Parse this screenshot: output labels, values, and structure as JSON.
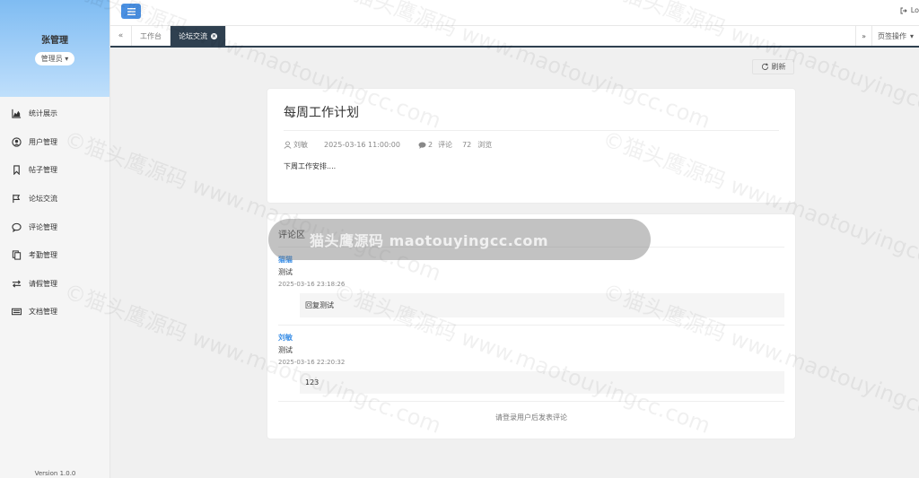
{
  "sidebar": {
    "user_name": "张管理",
    "role": "管理员",
    "items": [
      {
        "label": "统计展示",
        "icon": "area-chart-icon"
      },
      {
        "label": "用户管理",
        "icon": "user-circle-icon"
      },
      {
        "label": "帖子管理",
        "icon": "bookmark-icon"
      },
      {
        "label": "论坛交流",
        "icon": "flag-icon"
      },
      {
        "label": "评论管理",
        "icon": "comment-icon"
      },
      {
        "label": "考勤管理",
        "icon": "copy-icon"
      },
      {
        "label": "请假管理",
        "icon": "exchange-icon"
      },
      {
        "label": "文档管理",
        "icon": "keyboard-icon"
      }
    ],
    "version": "Version 1.0.0"
  },
  "topbar": {
    "logout_label": "Lo"
  },
  "tabs": {
    "items": [
      {
        "label": "工作台",
        "active": false
      },
      {
        "label": "论坛交流",
        "active": true
      }
    ],
    "page_ops_label": "页签操作"
  },
  "main": {
    "refresh_label": "刷新",
    "post": {
      "title": "每周工作计划",
      "author": "刘敏",
      "datetime": "2025-03-16 11:00:00",
      "comment_count": "2",
      "comment_label": "评论",
      "view_count": "72",
      "view_label": "浏览",
      "content": "下周工作安排...."
    },
    "comments": {
      "heading": "评论区",
      "items": [
        {
          "author": "猫猫",
          "text": "测试",
          "time": "2025-03-16 23:18:26",
          "reply": "回复测试"
        },
        {
          "author": "刘敏",
          "text": "测试",
          "time": "2025-03-16 22:20:32",
          "reply": "123"
        }
      ],
      "login_hint": "请登录用户后发表评论"
    }
  },
  "watermark": {
    "pill_text": "猫头鹰源码 maotouyingcc.com",
    "text": "©猫头鹰源码 www.maotouyingcc.com"
  },
  "colors": {
    "accent": "#4a90e2",
    "tab_active": "#2f4050",
    "link": "#3a8ee6"
  }
}
